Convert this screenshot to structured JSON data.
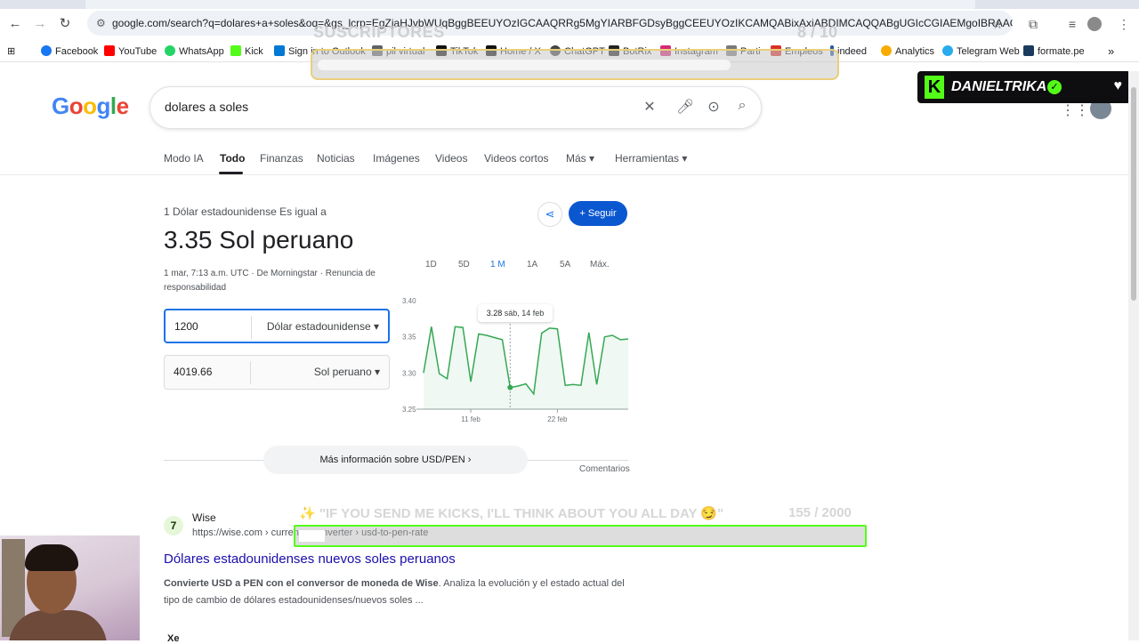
{
  "browser": {
    "url": "google.com/search?q=dolares+a+soles&oq=&gs_lcrp=EgZjaHJvbWUqBggBEEUYOzIGCAAQRRg5MgYIARBFGDsyBggCEEUYOzIKCAMQABixAxiABDIMCAQQABgUGIcCGIAEMgoIBRAAGLEDGIAEMgo...",
    "bookmarks": [
      {
        "label": "Facebook",
        "color": "#1877f2"
      },
      {
        "label": "YouTube",
        "color": "#ff0000"
      },
      {
        "label": "WhatsApp",
        "color": "#25d366"
      },
      {
        "label": "Kick",
        "color": "#53fc18"
      },
      {
        "label": "Sign in to Outlook",
        "color": "#0078d4"
      },
      {
        "label": "pil virtual",
        "color": "#5f6368"
      },
      {
        "label": "TikTok",
        "color": "#111111"
      },
      {
        "label": "Home / X",
        "color": "#111111"
      },
      {
        "label": "ChatGPT",
        "color": "#444444"
      },
      {
        "label": "BotRix",
        "color": "#222222"
      },
      {
        "label": "Instagram",
        "color": "#d62976"
      },
      {
        "label": "Parti",
        "color": "#7a7a7a"
      },
      {
        "label": "Empleos",
        "color": "#d93025"
      },
      {
        "label": "indeed",
        "color": "#2557a7"
      },
      {
        "label": "Analytics",
        "color": "#f9ab00"
      },
      {
        "label": "Telegram Web",
        "color": "#2aabee"
      },
      {
        "label": "formate.pe",
        "color": "#1a3b5d"
      }
    ]
  },
  "overlays": {
    "subscribers_label": "SUSCRIPTORES",
    "subscribers_count": "8 / 10",
    "subscribers_progress": 0.8,
    "streamer_name": "DANIELTRIKA",
    "goal_text": "✨ \"IF YOU SEND ME KICKS, I'LL THINK ABOUT YOU ALL DAY 😏\"",
    "goal_count": "155 / 2000",
    "goal_progress": 0.0775
  },
  "google": {
    "logo": "Google",
    "query": "dolares a soles",
    "tabs": [
      "Modo IA",
      "Todo",
      "Finanzas",
      "Noticias",
      "Imágenes",
      "Videos",
      "Videos cortos",
      "Más ▾",
      "Herramientas ▾"
    ],
    "active_tab": "Todo"
  },
  "fx": {
    "subtitle": "1 Dólar estadounidense Es igual a",
    "value": "3.35 Sol peruano",
    "meta": "1 mar, 7:13 a.m. UTC · De Morningstar · Renuncia de responsabilidad",
    "follow_label": "+ Seguir",
    "ranges": [
      "1D",
      "5D",
      "1 M",
      "1A",
      "5A",
      "Máx."
    ],
    "selected_range": "1 M",
    "from_amount": "1200",
    "from_currency": "Dólar estadounidense",
    "to_amount": "4019.66",
    "to_currency": "Sol peruano",
    "tooltip_value": "3.28",
    "tooltip_date": "sáb, 14 feb",
    "more_info": "Más información sobre USD/PEN  ›",
    "feedback": "Comentarios"
  },
  "chart_data": {
    "type": "line",
    "y_ticks": [
      "3.40",
      "3.35",
      "3.30",
      "3.25"
    ],
    "x_ticks": [
      "11 feb",
      "22 feb"
    ],
    "ylim": [
      3.25,
      3.4
    ],
    "color": "#34a853",
    "values": [
      3.3,
      3.364,
      3.299,
      3.292,
      3.364,
      3.363,
      3.288,
      3.354,
      3.352,
      3.349,
      3.346,
      3.28,
      3.282,
      3.285,
      3.271,
      3.355,
      3.362,
      3.361,
      3.283,
      3.284,
      3.283,
      3.356,
      3.284,
      3.35,
      3.352,
      3.346,
      3.347
    ],
    "highlight_index": 11
  },
  "result": {
    "site": "Wise",
    "url": "https://wise.com › currency-converter › usd-to-pen-rate",
    "title": "Dólares estadounidenses nuevos soles peruanos",
    "snippet_bold": "Convierte USD a PEN con el conversor de moneda de Wise",
    "snippet_rest": ". Analiza la evolución y el estado actual del tipo de cambio de dólares estadounidenses/nuevos soles ...",
    "next_site": "Xe"
  }
}
